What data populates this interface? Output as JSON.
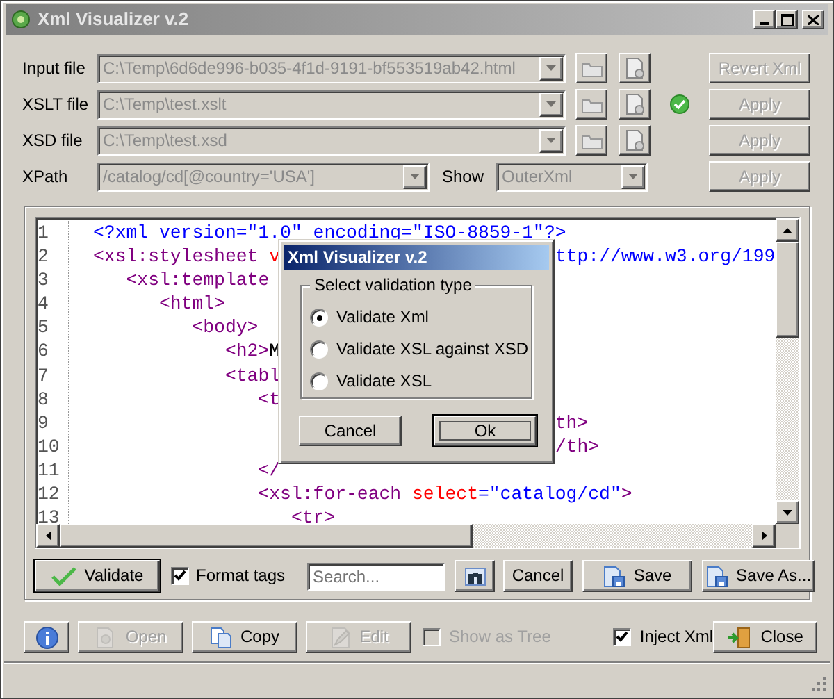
{
  "window": {
    "title": "Xml Visualizer v.2"
  },
  "file_rows": [
    {
      "label": "Input file",
      "value": "C:\\Temp\\6d6de996-b035-4f1d-9191-bf553519ab42.html",
      "disabled": true,
      "valid": false,
      "action": {
        "label": "Revert Xml",
        "disabled": true
      }
    },
    {
      "label": "XSLT file",
      "value": "C:\\Temp\\test.xslt",
      "disabled": true,
      "valid": true,
      "action": {
        "label": "Apply",
        "disabled": true
      }
    },
    {
      "label": "XSD file",
      "value": "C:\\Temp\\test.xsd",
      "disabled": true,
      "valid": false,
      "action": {
        "label": "Apply",
        "disabled": true
      }
    }
  ],
  "xpath_row": {
    "label": "XPath",
    "value": "/catalog/cd[@country='USA']",
    "disabled": true,
    "show_label": "Show",
    "show_value": "OuterXml",
    "action": {
      "label": "Apply",
      "disabled": true
    }
  },
  "editor": {
    "lines": [
      {
        "number": "1",
        "left": [
          {
            "text": "<?xml version=\"1.0\" encoding=\"ISO-8859-1\"?>",
            "kind": "value"
          }
        ]
      },
      {
        "number": "2",
        "left": [
          {
            "text": "<xsl:stylesheet",
            "kind": "tag"
          },
          {
            "text": " v",
            "kind": "attr"
          }
        ],
        "right": [
          {
            "text": "ttp://www.w3.org/199",
            "kind": "value"
          }
        ]
      },
      {
        "number": "3",
        "left": [
          {
            "text": "   <xsl:template ",
            "kind": "tag"
          }
        ]
      },
      {
        "number": "4",
        "left": [
          {
            "text": "      <html>",
            "kind": "tag"
          }
        ]
      },
      {
        "number": "5",
        "left": [
          {
            "text": "         <body>",
            "kind": "tag"
          }
        ]
      },
      {
        "number": "6",
        "left": [
          {
            "text": "            <h2>",
            "kind": "tag"
          },
          {
            "text": "M",
            "kind": "text"
          }
        ]
      },
      {
        "number": "7",
        "left": [
          {
            "text": "            <tabl",
            "kind": "tag"
          }
        ]
      },
      {
        "number": "8",
        "left": [
          {
            "text": "               <t",
            "kind": "tag"
          }
        ]
      },
      {
        "number": "9",
        "right": [
          {
            "text": "th>",
            "kind": "tag"
          }
        ]
      },
      {
        "number": "10",
        "right": [
          {
            "text": "/th>",
            "kind": "tag"
          }
        ]
      },
      {
        "number": "11",
        "left": [
          {
            "text": "               </",
            "kind": "tag"
          }
        ]
      },
      {
        "number": "12",
        "left": [
          {
            "text": "               <xsl:for-each ",
            "kind": "tag"
          },
          {
            "text": "select",
            "kind": "attr"
          },
          {
            "text": "=\"catalog/cd\"",
            "kind": "value"
          },
          {
            "text": ">",
            "kind": "tag"
          }
        ]
      },
      {
        "number": "13",
        "left": [
          {
            "text": "                  <tr>",
            "kind": "tag"
          }
        ]
      }
    ]
  },
  "toolbar": {
    "validate": "Validate",
    "format_tags": {
      "label": "Format tags",
      "checked": true
    },
    "search": {
      "placeholder": "Search..."
    },
    "buttons": [
      {
        "label": "Cancel",
        "kind": "plain"
      },
      {
        "label": "Save",
        "kind": "save"
      },
      {
        "label": "Save As...",
        "kind": "save"
      }
    ]
  },
  "footer": {
    "buttons": [
      {
        "kind": "info",
        "disabled": false
      },
      {
        "label": "Open",
        "kind": "open",
        "disabled": true
      },
      {
        "label": "Copy",
        "kind": "copy",
        "disabled": false
      },
      {
        "label": "Edit",
        "kind": "edit",
        "disabled": true
      }
    ],
    "checks": [
      {
        "label": "Show as Tree",
        "checked": false,
        "disabled": true
      },
      {
        "label": "Inject Xml",
        "checked": true,
        "disabled": false
      }
    ],
    "close": "Close"
  },
  "dialog": {
    "title": "Xml Visualizer v.2",
    "group": "Select validation type",
    "options": [
      {
        "label": "Validate Xml",
        "selected": true
      },
      {
        "label": "Validate XSL against XSD",
        "selected": false
      },
      {
        "label": "Validate XSL",
        "selected": false
      }
    ],
    "buttons": [
      {
        "label": "Cancel",
        "default": false
      },
      {
        "label": "Ok",
        "default": true
      }
    ]
  }
}
